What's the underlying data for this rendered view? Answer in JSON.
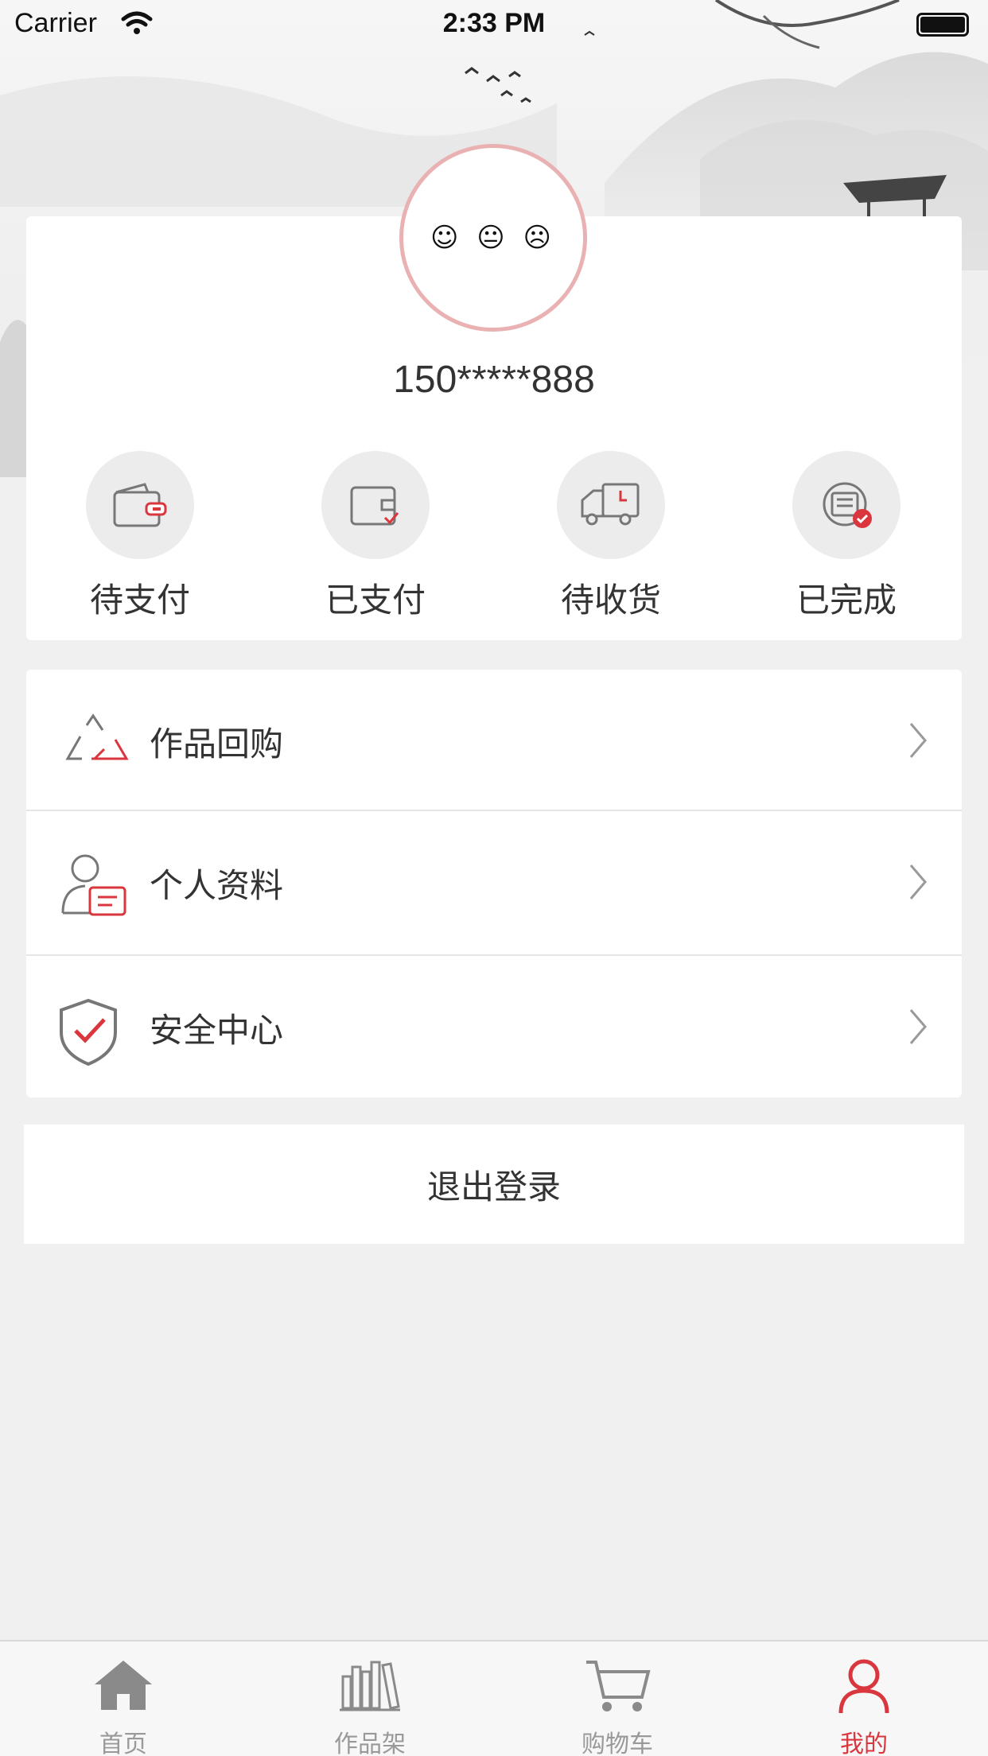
{
  "status_bar": {
    "carrier": "Carrier",
    "time": "2:33 PM"
  },
  "profile": {
    "avatar_text": "☺ 😐 ☹",
    "phone": "150*****888"
  },
  "orders": [
    {
      "label": "待支付",
      "icon": "wallet-pending-icon"
    },
    {
      "label": "已支付",
      "icon": "wallet-paid-icon"
    },
    {
      "label": "待收货",
      "icon": "delivery-truck-icon"
    },
    {
      "label": "已完成",
      "icon": "order-complete-icon"
    }
  ],
  "menu": [
    {
      "label": "作品回购",
      "icon": "recycle-icon"
    },
    {
      "label": "个人资料",
      "icon": "profile-card-icon"
    },
    {
      "label": "安全中心",
      "icon": "shield-check-icon"
    }
  ],
  "logout_label": "退出登录",
  "tabs": [
    {
      "label": "首页",
      "icon": "home-icon",
      "active": false
    },
    {
      "label": "作品架",
      "icon": "bookshelf-icon",
      "active": false
    },
    {
      "label": "购物车",
      "icon": "cart-icon",
      "active": false
    },
    {
      "label": "我的",
      "icon": "user-icon",
      "active": true
    }
  ],
  "colors": {
    "accent": "#d9363e",
    "avatar_border": "#e9b1b1",
    "background": "#f0f0f0"
  }
}
